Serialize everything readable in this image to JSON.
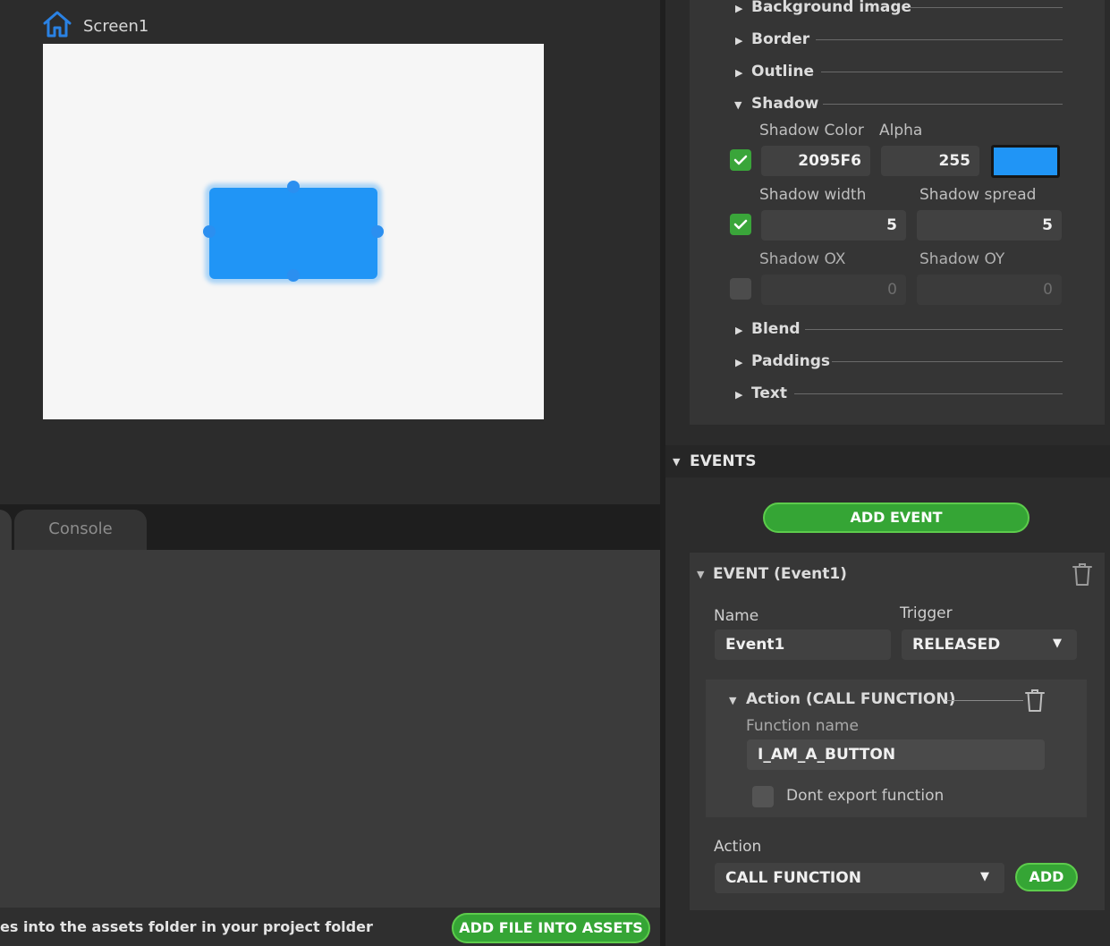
{
  "canvas": {
    "screen_name": "Screen1",
    "widget_color": "#2095F6"
  },
  "bottom_panel": {
    "tabs": [
      "Console"
    ],
    "hint_text": "es into the assets folder in your project folder",
    "add_file_label": "ADD FILE INTO ASSETS"
  },
  "properties": {
    "collapsed_top": [
      "Background image",
      "Border",
      "Outline"
    ],
    "shadow": {
      "title": "Shadow",
      "expanded": true,
      "color_label": "Shadow Color",
      "alpha_label": "Alpha",
      "color_value": "2095F6",
      "alpha_value": "255",
      "color_checked": true,
      "swatch_color": "#2095F6",
      "width_label": "Shadow width",
      "spread_label": "Shadow spread",
      "width_value": "5",
      "spread_value": "5",
      "size_checked": true,
      "ox_label": "Shadow OX",
      "oy_label": "Shadow OY",
      "ox_value": "0",
      "oy_value": "0",
      "offset_checked": false
    },
    "collapsed_bottom": [
      "Blend",
      "Paddings",
      "Text"
    ]
  },
  "events": {
    "title": "EVENTS",
    "add_event_label": "ADD EVENT",
    "event": {
      "title": "EVENT (Event1)",
      "name_label": "Name",
      "name_value": "Event1",
      "trigger_label": "Trigger",
      "trigger_value": "RELEASED",
      "action": {
        "title": "Action (CALL FUNCTION)",
        "function_name_label": "Function name",
        "function_name_value": "I_AM_A_BUTTON",
        "dont_export_label": "Dont export function",
        "dont_export_checked": false
      },
      "action_select_label": "Action",
      "action_select_value": "CALL FUNCTION",
      "add_label": "ADD"
    }
  },
  "colors": {
    "accent_green": "#35A535",
    "widget_blue": "#2095F6"
  }
}
